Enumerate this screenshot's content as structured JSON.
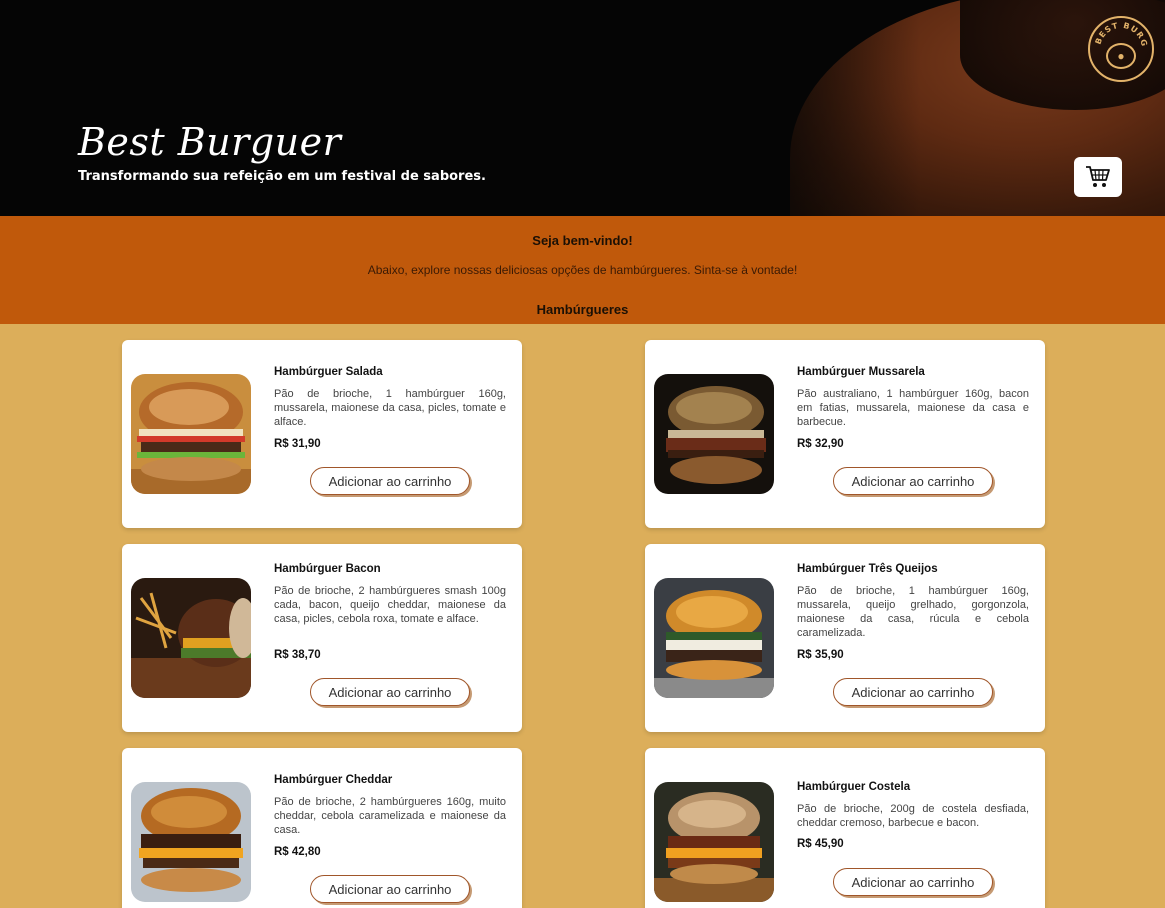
{
  "header": {
    "title": "Best Burguer",
    "subtitle": "Transformando sua refeição em um festival de sabores.",
    "logo_text": "BEST BURGER",
    "cart_icon": "cart-icon"
  },
  "welcome": {
    "title": "Seja bem-vindo!",
    "text": "Abaixo, explore nossas deliciosas opções de hambúrgueres. Sinta-se à vontade!",
    "section": "Hambúrgueres"
  },
  "products": [
    {
      "name": "Hambúrguer Salada",
      "desc": "Pão de brioche, 1 hambúrguer 160g, mussarela, maionese da casa, picles, tomate e alface.",
      "price": "R$ 31,90",
      "button": "Adicionar ao carrinho"
    },
    {
      "name": "Hambúrguer Mussarela",
      "desc": "Pão australiano, 1 hambúrguer 160g, bacon em fatias, mussarela, maionese da casa e barbecue.",
      "price": "R$ 32,90",
      "button": "Adicionar ao carrinho"
    },
    {
      "name": "Hambúrguer Bacon",
      "desc": "Pão de brioche, 2 hambúrgueres smash 100g cada, bacon, queijo cheddar, maionese da casa, picles, cebola roxa, tomate e alface.",
      "price": "R$ 38,70",
      "button": "Adicionar ao carrinho"
    },
    {
      "name": "Hambúrguer Três Queijos",
      "desc": "Pão de brioche, 1 hambúrguer 160g, mussarela, queijo grelhado, gorgonzola, maionese da casa, rúcula e cebola caramelizada.",
      "price": "R$ 35,90",
      "button": "Adicionar ao carrinho"
    },
    {
      "name": "Hambúrguer Cheddar",
      "desc": "Pão de brioche, 2 hambúrgueres 160g, muito cheddar, cebola caramelizada e maionese da casa.",
      "price": "R$ 42,80",
      "button": "Adicionar ao carrinho"
    },
    {
      "name": "Hambúrguer Costela",
      "desc": "Pão de brioche, 200g de costela desfiada, cheddar cremoso, barbecue e bacon.",
      "price": "R$ 45,90",
      "button": "Adicionar ao carrinho"
    }
  ],
  "colors": {
    "band": "#c0590b",
    "background": "#dcae5a",
    "button_border": "#a0562a"
  }
}
